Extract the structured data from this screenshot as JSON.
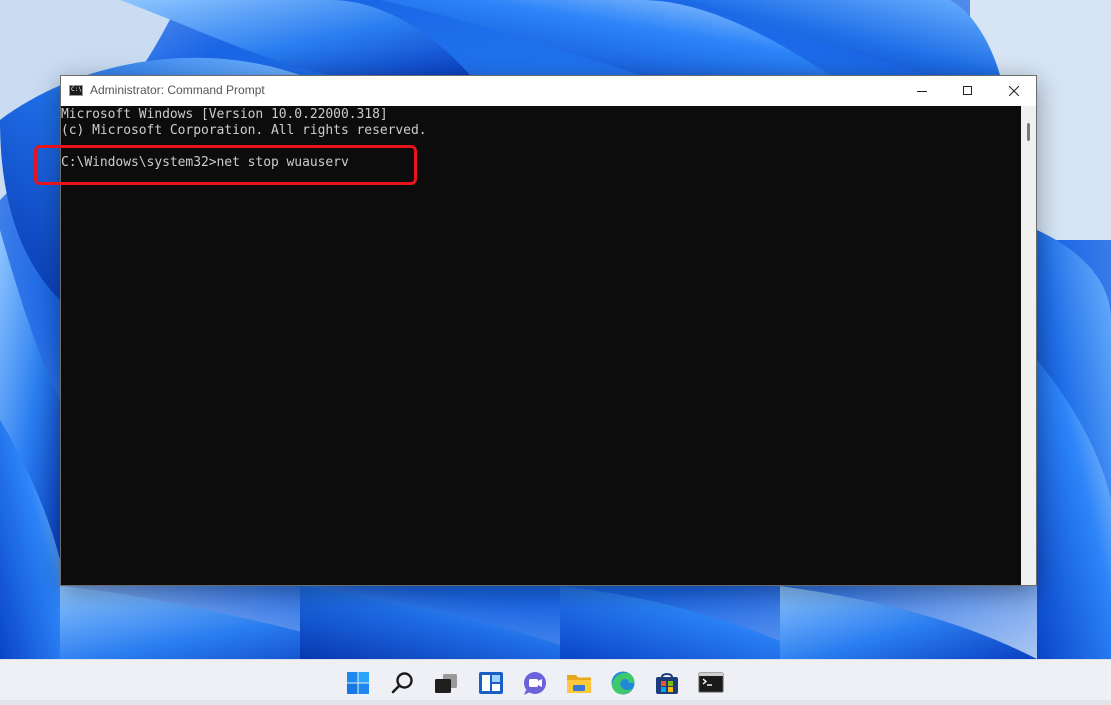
{
  "window": {
    "title": "Administrator: Command Prompt",
    "icon": "cmd-icon",
    "icon_text": "C:\\"
  },
  "console": {
    "lines": [
      "Microsoft Windows [Version 10.0.22000.318]",
      "(c) Microsoft Corporation. All rights reserved.",
      "C:\\Windows\\system32>net stop wuauserv"
    ],
    "text_color": "#cccccc",
    "background": "#0c0c0c"
  },
  "highlight": {
    "color": "#e8141c"
  },
  "taskbar": {
    "icons": [
      "windows-start-icon",
      "search-icon",
      "task-view-icon",
      "widgets-icon",
      "chat-icon",
      "file-explorer-icon",
      "edge-icon",
      "microsoft-store-icon",
      "terminal-icon"
    ]
  },
  "colors": {
    "wallpaper_blue": "#1f6fe8",
    "taskbar": "#eef0f5"
  }
}
